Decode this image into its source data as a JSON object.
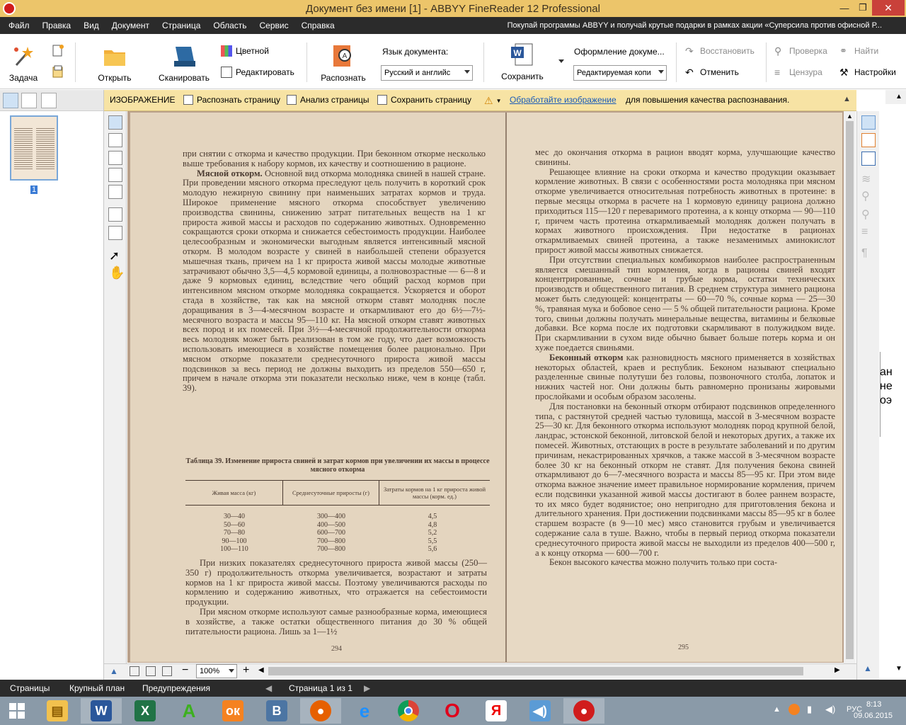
{
  "window": {
    "title": "Документ без имени [1] - ABBYY FineReader 12 Professional"
  },
  "menu": {
    "items": [
      "Файл",
      "Правка",
      "Вид",
      "Документ",
      "Страница",
      "Область",
      "Сервис",
      "Справка"
    ],
    "promo": "Покупай программы ABBYY и получай крутые подарки в рамках акции «Суперсила против офисной Р..."
  },
  "toolbar": {
    "task": "Задача",
    "open": "Открыть",
    "scan": "Сканировать",
    "color": "Цветной",
    "edit": "Редактировать",
    "recognize": "Распознать",
    "lang_label": "Язык документа:",
    "lang_value": "Русский и английс",
    "save": "Сохранить",
    "format_label": "Оформление докуме...",
    "format_value": "Редактируемая копи",
    "restore": "Восстановить",
    "undo": "Отменить",
    "check": "Проверка",
    "censor": "Цензура",
    "find": "Найти",
    "settings": "Настройки"
  },
  "image_bar": {
    "title": "ИЗОБРАЖЕНИЕ",
    "recognize_page": "Распознать страницу",
    "analyze_page": "Анализ страницы",
    "save_page": "Сохранить страницу",
    "process_link": "Обработайте изображение",
    "hint": "для повышения качества распознавания."
  },
  "thumbnail": {
    "page_label": "1"
  },
  "page_left": {
    "p1": "при снятии с откорма и качество продукции. При беконном откорме несколько выше требования к набору кормов, их качеству и соотношению в рационе.",
    "p2_head": "Мясной откорм.",
    "p2": " Основной вид откорма молодняка свиней в нашей стране. При проведении мясного откорма преследуют цель получить в короткий срок молодую нежирную свинину при наименьших затратах кормов и труда. Широкое применение мясного откорма способствует увеличению производства свинины, снижению затрат питательных веществ на 1 кг прироста живой массы и расходов по содержанию животных. Одновременно сокращаются сроки откорма и снижается себестоимость продукции. Наиболее целесообразным и экономически выгодным является интенсивный мясной откорм. В молодом возрасте у свиней в наибольшей степени образуется мышечная ткань, причем на 1 кг прироста живой массы молодые животные затрачивают обычно 3,5—4,5 кормовой единицы, а полновозрастные — 6—8 и даже 9 кормовых единиц, вследствие чего общий расход кормов при интенсивном мясном откорме молодняка сокращается. Ускоряется и оборот стада в хозяйстве, так как на мясной откорм ставят молодняк после доращивания в 3—4-месячном возрасте и откармливают его до 6½—7½-месячного возраста и массы 95—110 кг. На мясной откорм ставят животных всех пород и их помесей. При 3½—4-месячной продолжительности откорма весь молодняк может быть реализован в том же году, что дает возможность использовать имеющиеся в хозяйстве помещения более рационально. При мясном откорме показатели среднесуточного прироста живой массы подсвинков за весь период не должны выходить из пределов 550—650 г, причем в начале откорма эти показатели несколько ниже, чем в конце (табл. 39).",
    "table_caption": "Таблица 39. Изменение прироста свиней и затрат кормов при увеличении их массы в процессе мясного откорма",
    "table_headers": [
      "Живая масса (кг)",
      "Среднесуточные приросты (г)",
      "Затраты кормов на 1 кг прироста живой массы (корм. ед.)"
    ],
    "table_rows": [
      [
        "30—40",
        "300—400",
        "4,5"
      ],
      [
        "50—60",
        "400—500",
        "4,8"
      ],
      [
        "70—80",
        "600—700",
        "5,2"
      ],
      [
        "90—100",
        "700—800",
        "5,5"
      ],
      [
        "100—110",
        "700—800",
        "5,6"
      ]
    ],
    "p3": "При низких показателях среднесуточного прироста живой массы (250—350 г) продолжительность откорма увеличивается, возрастают и затраты кормов на 1 кг прироста живой массы. Поэтому увеличиваются расходы по кормлению и содержанию животных, что отражается на себестоимости продукции.",
    "p4": "При мясном откорме используют самые разнообразные корма, имеющиеся в хозяйстве, а также остатки общественного питания до 30 % общей питательности рациона. Лишь за 1—1½",
    "page_number": "294"
  },
  "page_right": {
    "p1": "мес до окончания откорма в рацион вводят корма, улучшающие качество свинины.",
    "p2": "Решающее влияние на сроки откорма и качество продукции оказывает кормление животных. В связи с особенностями роста молодняка при мясном откорме увеличивается относительная потребность животных в протеине: в первые месяцы откорма в расчете на 1 кормовую единицу рациона должно приходиться 115—120 г переваримого протеина, а к концу откорма — 90—110 г, причем часть протеина откармливаемый молодняк должен получать в кормах животного происхождения. При недостатке в рационах откармливаемых свиней протеина, а также незаменимых аминокислот прирост живой массы животных снижается.",
    "p3": "При отсутствии специальных комбикормов наиболее распространенным является смешанный тип кормления, когда в рационы свиней входят концентрированные, сочные и грубые корма, остатки технических производств и общественного питания. В среднем структура зимнего рациона может быть следующей: концентраты — 60—70 %, сочные корма — 25—30 %, травяная мука и бобовое сено — 5 % общей питательности рациона. Кроме того, свиньи должны получать минеральные вещества, витамины и белковые добавки. Все корма после их подготовки скармливают в полужидком виде. При скармливании в сухом виде обычно бывает больше потерь корма и он хуже поедается свиньями.",
    "p4_head": "Беконный откорм",
    "p4": " как разновидность мясного применяется в хозяйствах некоторых областей, краев и республик. Беконом называют специально разделенные свиные полутуши без головы, позвоночного столба, лопаток и нижних частей ног. Они должны быть равномерно пронизаны жировыми прослойками и особым образом засолены.",
    "p5": "Для постановки на беконный откорм отбирают подсвинков определенного типа, с растянутой средней частью туловища, массой в 3-месячном возрасте 25—30 кг. Для беконного откорма используют молодняк пород крупной белой, ландрас, эстонской беконной, литовской белой и некоторых других, а также их помесей. Животных, отстающих в росте в результате заболеваний и по другим причинам, некастрированных хрячков, а также массой в 3-месячном возрасте более 30 кг на беконный откорм не ставят. Для получения бекона свиней откармливают до 6—7-месячного возраста и массы 85—95 кг. При этом виде откорма важное значение имеет правильное нормирование кормления, причем если подсвинки указанной живой массы достигают в более раннем возрасте, то их мясо будет водянистое; оно непригодно для приготовления бекона и длительного хранения. При достижении подсвинками массы 85—95 кг в более старшем возрасте (в 9—10 мес) мясо становится грубым и увеличивается содержание сала в туше. Важно, чтобы в первый период откорма показатели среднесуточного прироста живой массы не выходили из пределов 400—500 г, а к концу откорма — 600—700 г.",
    "p6": "Бекон высокого качества можно получить только при соста-",
    "page_number": "295"
  },
  "zoom": {
    "value": "100%"
  },
  "far_right_text": [
    "ан",
    "не",
    "оэ"
  ],
  "statusbar": {
    "pages": "Страницы",
    "closeup": "Крупный план",
    "warnings": "Предупреждения",
    "page_info": "Страница 1 из 1"
  },
  "taskbar": {
    "lang": "РУС",
    "time": "8:13",
    "date": "09.06.2015",
    "apps": [
      "windows-start",
      "file-explorer",
      "word",
      "excel",
      "app-a",
      "odnoklassniki",
      "vkontakte",
      "firefox",
      "internet-explorer",
      "chrome",
      "opera",
      "yandex",
      "speaker-app",
      "finereader"
    ]
  },
  "colors": {
    "titlebar": "#ecc56a",
    "menubar": "#2b2b2b",
    "image_bar": "#f7e3a4",
    "page": "#e4d5bf",
    "link": "#1a5bb8",
    "taskbar": "#8a9aa8"
  }
}
